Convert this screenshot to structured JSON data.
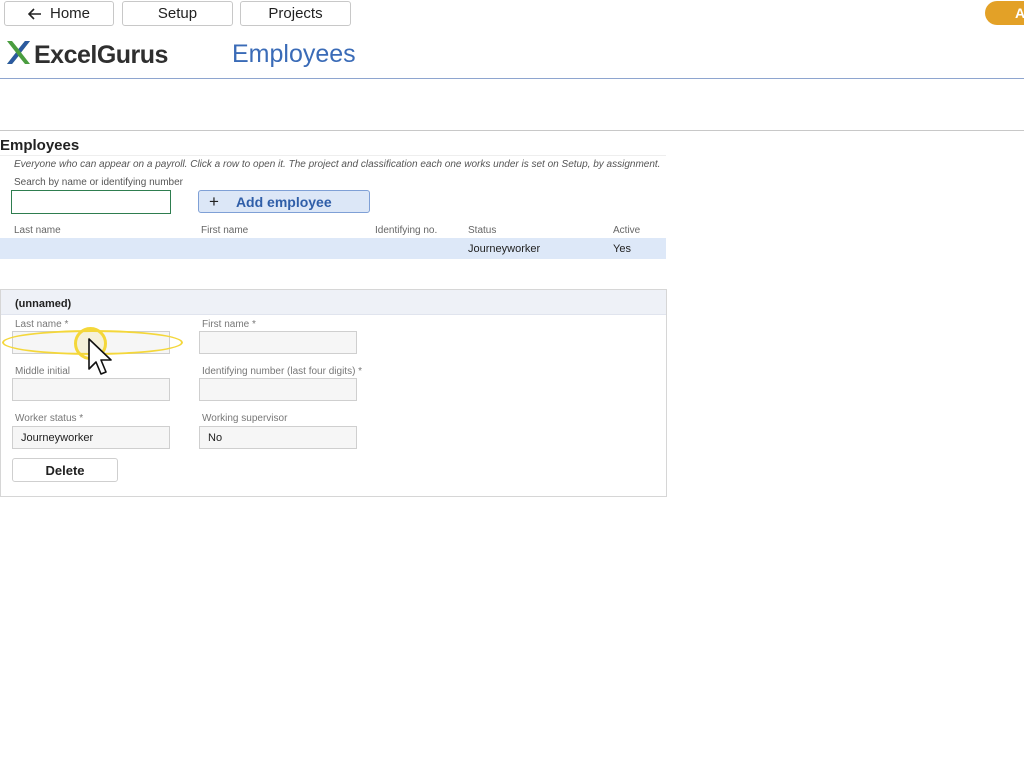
{
  "nav": {
    "home_label": "Home",
    "setup_label": "Setup",
    "projects_label": "Projects",
    "account_initial": "A"
  },
  "brand": {
    "logo_text": "ExcelGurus",
    "page_title": "Employees"
  },
  "employees": {
    "section_title": "Employees",
    "description": "Everyone who can appear on a payroll. Click a row to open it. The project and classification each one works under is set on Setup, by assignment.",
    "search_label": "Search by name or identifying number",
    "search_value": "",
    "add_button_label": "Add employee",
    "columns": [
      "Last name",
      "First name",
      "Identifying no.",
      "Status",
      "Active"
    ],
    "rows": [
      {
        "last_name": "",
        "first_name": "",
        "identifying_no": "",
        "status": "Journeyworker",
        "active": "Yes"
      }
    ]
  },
  "detail": {
    "title": "(unnamed)",
    "last_name_label": "Last name *",
    "last_name_value": "",
    "first_name_label": "First name *",
    "first_name_value": "",
    "middle_initial_label": "Middle initial",
    "middle_initial_value": "",
    "identifying_label": "Identifying number (last four digits) *",
    "identifying_value": "",
    "worker_status_label": "Worker status *",
    "worker_status_value": "Journeyworker",
    "supervisor_label": "Working supervisor",
    "supervisor_value": "No",
    "delete_label": "Delete"
  },
  "colors": {
    "accent_blue": "#3a6bb7",
    "selected_row": "#dde8f8",
    "account_orange": "#e3a127",
    "highlight_yellow": "#f4d73a",
    "search_border_green": "#2e7d4f"
  },
  "icons": {
    "back": "arrow-left-icon",
    "logo": "excelgurus-x-logo-icon",
    "add": "plus-icon",
    "pointer": "mouse-pointer-icon"
  }
}
